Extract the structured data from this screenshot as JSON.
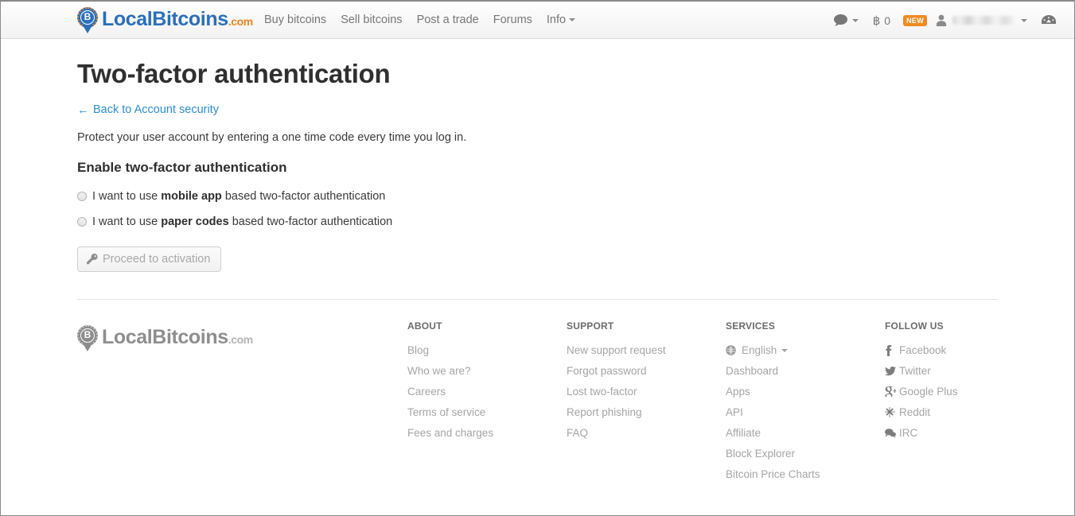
{
  "header": {
    "brand": {
      "local": "Local",
      "bitcoins": "Bitcoins",
      "com": ".com",
      "mark_letter": "B"
    },
    "nav": [
      {
        "label": "Buy bitcoins",
        "has_caret": false
      },
      {
        "label": "Sell bitcoins",
        "has_caret": false
      },
      {
        "label": "Post a trade",
        "has_caret": false
      },
      {
        "label": "Forums",
        "has_caret": false
      },
      {
        "label": "Info",
        "has_caret": true
      }
    ],
    "right": {
      "messages_icon": "speech-bubble-icon",
      "bitcoin_symbol": "฿",
      "balance": "0",
      "new_badge": "NEW",
      "user_icon": "user-icon",
      "username": "",
      "dashboard_icon": "dashboard-icon"
    }
  },
  "main": {
    "title": "Two-factor authentication",
    "back_link": "Back to Account security",
    "back_arrow": "←",
    "intro": "Protect your user account by entering a one time code every time you log in.",
    "section_title": "Enable two-factor authentication",
    "options": [
      {
        "prefix": "I want to use ",
        "bold": "mobile app",
        "suffix": " based two-factor authentication",
        "selected": false
      },
      {
        "prefix": "I want to use ",
        "bold": "paper codes",
        "suffix": " based two-factor authentication",
        "selected": false
      }
    ],
    "proceed_button": {
      "label": "Proceed to activation",
      "icon": "key-icon",
      "disabled": true
    }
  },
  "footer": {
    "brand": {
      "local": "Local",
      "bitcoins": "Bitcoins",
      "com": ".com",
      "mark_letter": "B"
    },
    "columns": [
      {
        "heading": "ABOUT",
        "links": [
          {
            "label": "Blog"
          },
          {
            "label": "Who we are?"
          },
          {
            "label": "Careers"
          },
          {
            "label": "Terms of service"
          },
          {
            "label": "Fees and charges"
          }
        ]
      },
      {
        "heading": "SUPPORT",
        "links": [
          {
            "label": "New support request"
          },
          {
            "label": "Forgot password"
          },
          {
            "label": "Lost two-factor"
          },
          {
            "label": "Report phishing"
          },
          {
            "label": "FAQ"
          }
        ]
      },
      {
        "heading": "SERVICES",
        "links": [
          {
            "label": "English",
            "icon": "globe-icon",
            "caret": true
          },
          {
            "label": "Dashboard"
          },
          {
            "label": "Apps"
          },
          {
            "label": "API"
          },
          {
            "label": "Affiliate"
          },
          {
            "label": "Block Explorer"
          },
          {
            "label": "Bitcoin Price Charts"
          }
        ]
      },
      {
        "heading": "FOLLOW US",
        "links": [
          {
            "label": "Facebook",
            "icon": "facebook-icon"
          },
          {
            "label": "Twitter",
            "icon": "twitter-icon"
          },
          {
            "label": "Google Plus",
            "icon": "google-plus-icon"
          },
          {
            "label": "Reddit",
            "icon": "reddit-icon"
          },
          {
            "label": "IRC",
            "icon": "irc-icon"
          }
        ]
      }
    ]
  },
  "colors": {
    "brand_blue": "#2a6fbb",
    "brand_orange": "#ef8321",
    "link_blue": "#2a8fd4",
    "badge_orange": "#f18a21",
    "text_dark": "#2f2f2f",
    "text_muted": "#a5a5a5"
  }
}
